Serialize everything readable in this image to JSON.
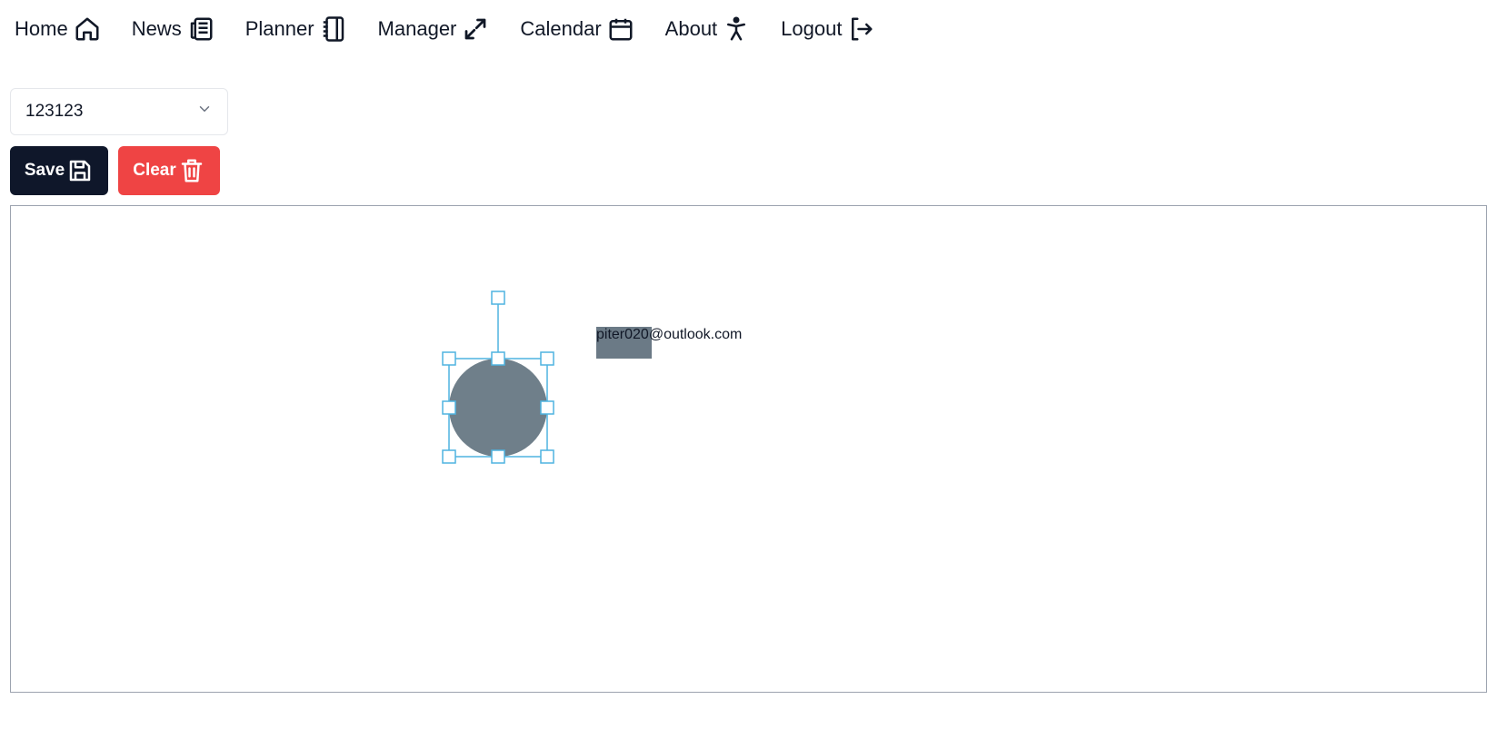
{
  "nav": {
    "items": [
      {
        "label": "Home",
        "icon": "home-icon"
      },
      {
        "label": "News",
        "icon": "newspaper-icon"
      },
      {
        "label": "Planner",
        "icon": "notebook-icon"
      },
      {
        "label": "Manager",
        "icon": "expand-arrows-icon"
      },
      {
        "label": "Calendar",
        "icon": "calendar-icon"
      },
      {
        "label": "About",
        "icon": "accessibility-icon"
      },
      {
        "label": "Logout",
        "icon": "logout-icon"
      }
    ]
  },
  "selector": {
    "value": "123123"
  },
  "toolbar": {
    "save_label": "Save",
    "clear_label": "Clear"
  },
  "canvas": {
    "text": "piter020@outlook.com",
    "shape_fill": "#6f7f8a",
    "selection_color": "#4fb3e0"
  },
  "colors": {
    "save_bg": "#0f172a",
    "clear_bg": "#ef4444"
  }
}
